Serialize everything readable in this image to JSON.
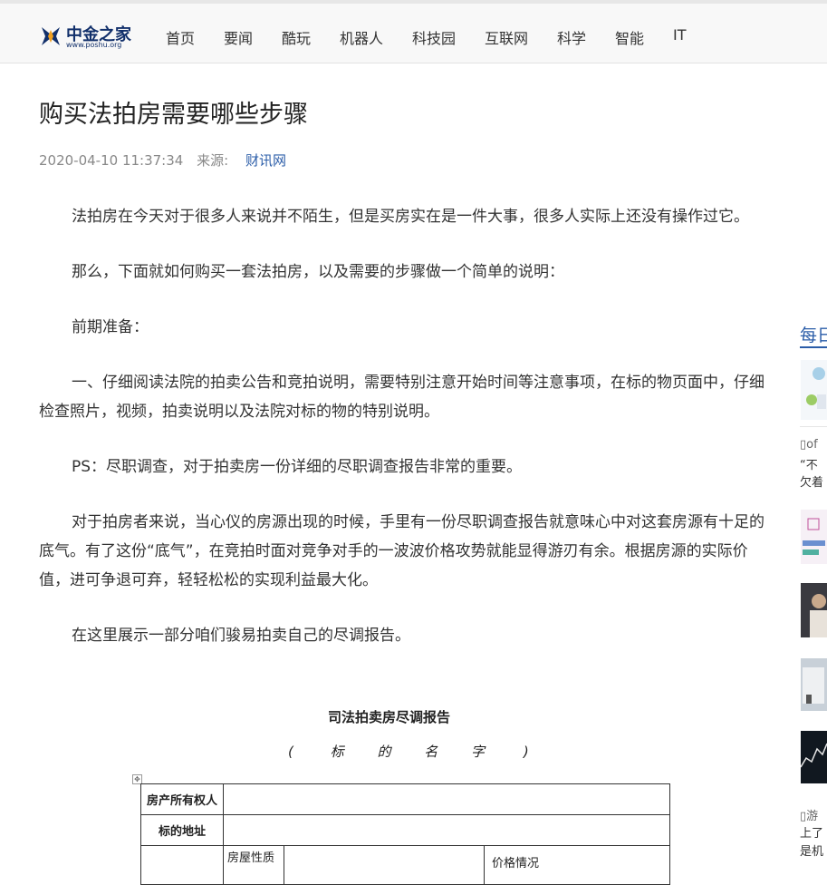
{
  "site": {
    "logo_text": "中金之家",
    "logo_url": "www.poshu.org"
  },
  "nav": [
    "首页",
    "要闻",
    "酷玩",
    "机器人",
    "科技园",
    "互联网",
    "科学",
    "智能",
    "IT"
  ],
  "article": {
    "title": "购买法拍房需要哪些步骤",
    "datetime": "2020-04-10 11:37:34",
    "source_label": "来源:",
    "source": "财讯网",
    "paragraphs": [
      "法拍房在今天对于很多人来说并不陌生，但是买房实在是一件大事，很多人实际上还没有操作过它。",
      "那么，下面就如何购买一套法拍房，以及需要的步骤做一个简单的说明：",
      "前期准备：",
      "一、仔细阅读法院的拍卖公告和竞拍说明，需要特别注意开始时间等注意事项，在标的物页面中，仔细检查照片，视频，拍卖说明以及法院对标的物的特别说明。",
      "PS：尽职调查，对于拍卖房一份详细的尽职调查报告非常的重要。",
      "对于拍房者来说，当心仪的房源出现的时候，手里有一份尽职调查报告就意味心中对这套房源有十足的底气。有了这份“底气”，在竞拍时面对竞争对手的一波波价格攻势就能显得游刃有余。根据房源的实际价值，进可争退可弃，轻轻松松的实现利益最大化。",
      "在这里展示一部分咱们骏易拍卖自己的尽调报告。"
    ]
  },
  "report": {
    "title": "司法拍卖房尽调报告",
    "subtitle_open": "(",
    "subtitle_chars": [
      "标",
      "的",
      "名",
      "字"
    ],
    "subtitle_close": ")",
    "rows": {
      "owner": "房产所有权人",
      "address": "标的地址",
      "nature": "房屋性质",
      "price": "价格情况"
    }
  },
  "sidebar": {
    "title": "每日",
    "items": [
      {
        "text": "“不",
        "sub": "欠着",
        "alt": "of"
      },
      {
        "text": "上了",
        "sub": "是机",
        "alt": "游"
      }
    ]
  },
  "colors": {
    "brand": "#12306b",
    "link": "#2a5ca8",
    "logo_orange": "#f0a020"
  }
}
